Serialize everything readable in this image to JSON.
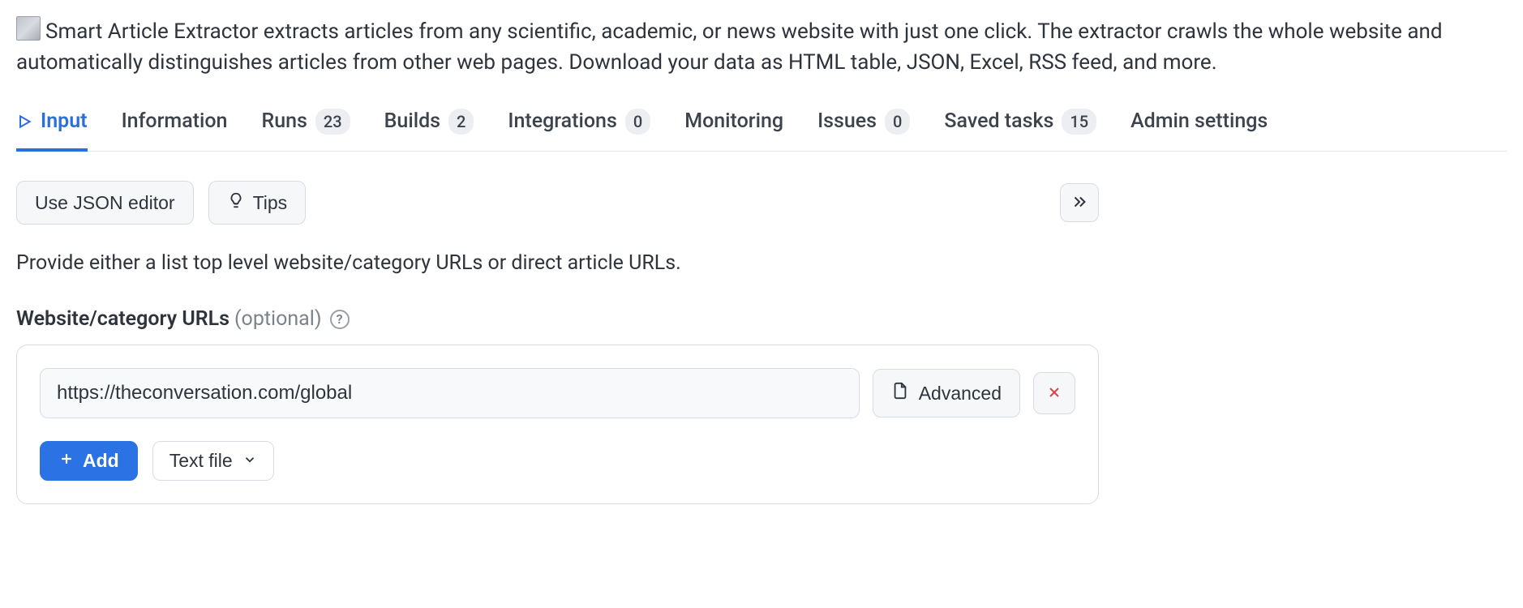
{
  "description": "Smart Article Extractor extracts articles from any scientific, academic, or news website with just one click. The extractor crawls the whole website and automatically distinguishes articles from other web pages. Download your data as HTML table, JSON, Excel, RSS feed, and more.",
  "tabs": [
    {
      "label": "Input",
      "badge": null,
      "active": true
    },
    {
      "label": "Information",
      "badge": null,
      "active": false
    },
    {
      "label": "Runs",
      "badge": "23",
      "active": false
    },
    {
      "label": "Builds",
      "badge": "2",
      "active": false
    },
    {
      "label": "Integrations",
      "badge": "0",
      "active": false
    },
    {
      "label": "Monitoring",
      "badge": null,
      "active": false
    },
    {
      "label": "Issues",
      "badge": "0",
      "active": false
    },
    {
      "label": "Saved tasks",
      "badge": "15",
      "active": false
    },
    {
      "label": "Admin settings",
      "badge": null,
      "active": false
    }
  ],
  "toolbar": {
    "json_editor_label": "Use JSON editor",
    "tips_label": "Tips"
  },
  "section": {
    "instruction": "Provide either a list top level website/category URLs or direct article URLs.",
    "field_label": "Website/category URLs",
    "optional_text": "(optional)",
    "url_value": "https://theconversation.com/global",
    "advanced_label": "Advanced",
    "add_label": "Add",
    "file_label": "Text file"
  }
}
